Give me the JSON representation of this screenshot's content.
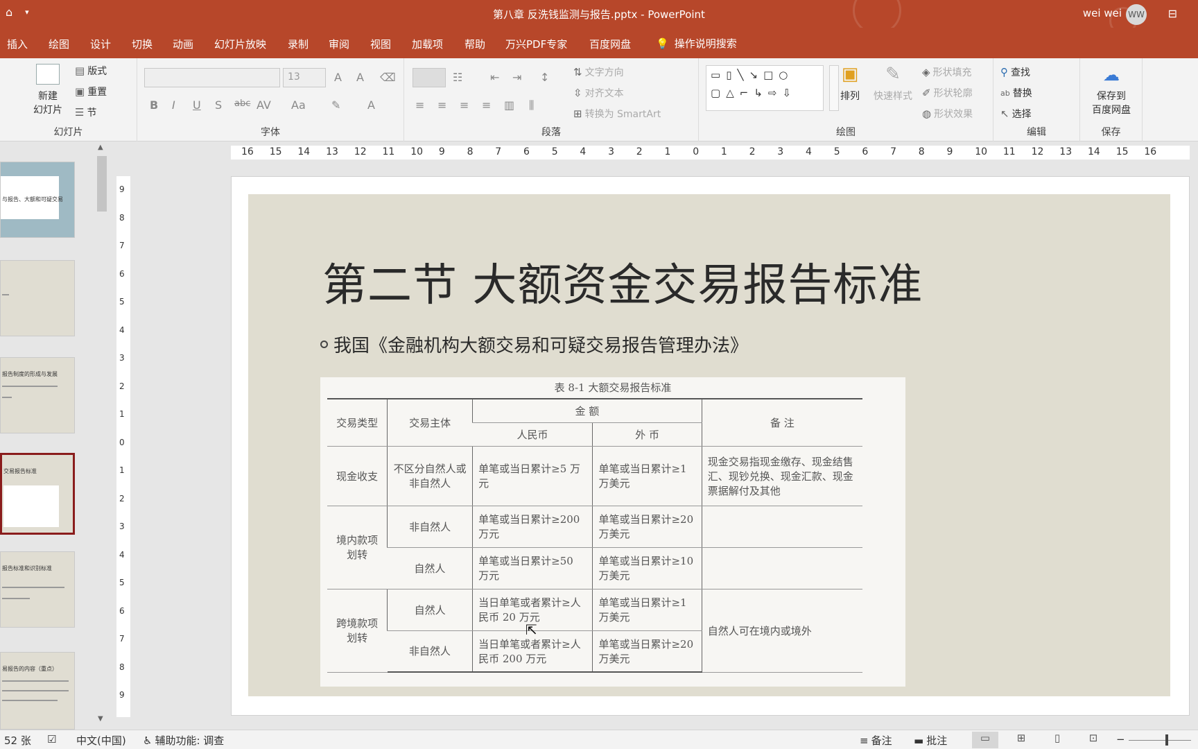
{
  "window": {
    "title": "第八章 反洗钱监测与报告.pptx  -  PowerPoint",
    "user_name": "wei wei",
    "avatar_initials": "WW"
  },
  "menu": {
    "tabs": [
      "插入",
      "绘图",
      "设计",
      "切换",
      "动画",
      "幻灯片放映",
      "录制",
      "审阅",
      "视图",
      "加载项",
      "帮助",
      "万兴PDF专家",
      "百度网盘"
    ],
    "tell_me": "操作说明搜索"
  },
  "ribbon": {
    "slides_group": {
      "label": "幻灯片",
      "new_slide": "新建",
      "new_slide_sub": "幻灯片",
      "layout": "版式",
      "reset": "重置",
      "section": "节"
    },
    "font_group": {
      "label": "字体",
      "font_size": "13",
      "bold": "B",
      "italic": "I",
      "underline": "U",
      "shadow": "S",
      "strike": "abc",
      "spacing": "AV",
      "case": "Aa"
    },
    "paragraph_group": {
      "label": "段落",
      "text_direction": "文字方向",
      "align_text": "对齐文本",
      "convert_smartart": "转换为 SmartArt"
    },
    "drawing_group": {
      "label": "绘图",
      "arrange": "排列",
      "quick_styles": "快速样式",
      "shape_fill": "形状填充",
      "shape_outline": "形状轮廓",
      "shape_effects": "形状效果"
    },
    "editing_group": {
      "label": "编辑",
      "find": "查找",
      "replace": "替换",
      "select": "选择"
    },
    "save_group": {
      "label": "保存",
      "save_to": "保存到",
      "save_to_sub": "百度网盘"
    }
  },
  "thumbnails": [
    {
      "title": "与报告、大额和可疑交易",
      "selected": false
    },
    {
      "title": "",
      "selected": false
    },
    {
      "title": "报告制度的形成与发展",
      "selected": false
    },
    {
      "title": "交易报告标准",
      "selected": true
    },
    {
      "title": "报告标准和识别标准",
      "selected": false
    },
    {
      "title": "易报告的内容（重点）",
      "selected": false
    }
  ],
  "ruler": {
    "h_labels": [
      "16",
      "15",
      "14",
      "13",
      "12",
      "11",
      "10",
      "9",
      "8",
      "7",
      "6",
      "5",
      "4",
      "3",
      "2",
      "1",
      "0",
      "1",
      "2",
      "3",
      "4",
      "5",
      "6",
      "7",
      "8",
      "9",
      "10",
      "11",
      "12",
      "13",
      "14",
      "15",
      "16"
    ],
    "v_labels": [
      "9",
      "8",
      "7",
      "6",
      "5",
      "4",
      "3",
      "2",
      "1",
      "0",
      "1",
      "2",
      "3",
      "4",
      "5",
      "6",
      "7",
      "8",
      "9"
    ]
  },
  "slide": {
    "title": "第二节 大额资金交易报告标准",
    "bullet": "我国《金融机构大额交易和可疑交易报告管理办法》",
    "table": {
      "caption": "表 8-1   大额交易报告标准",
      "headers": {
        "type": "交易类型",
        "subject": "交易主体",
        "amount": "金    额",
        "rmb": "人民币",
        "fx": "外   币",
        "note": "备     注"
      },
      "rows": [
        {
          "type": "现金收支",
          "subject": "不区分自然人或非自然人",
          "rmb": "单笔或当日累计≥5 万元",
          "fx": "单笔或当日累计≥1 万美元",
          "note": "现金交易指现金缴存、现金结售汇、现钞兑换、现金汇款、现金票据解付及其他"
        },
        {
          "type": "境内款项划转",
          "subject": "非自然人",
          "rmb": "单笔或当日累计≥200 万元",
          "fx": "单笔或当日累计≥20 万美元",
          "note": ""
        },
        {
          "type": "",
          "subject": "自然人",
          "rmb": "单笔或当日累计≥50 万元",
          "fx": "单笔或当日累计≥10 万美元",
          "note": ""
        },
        {
          "type": "跨境款项划转",
          "subject": "自然人",
          "rmb": "当日单笔或者累计≥人民币 20 万元",
          "fx": "单笔或当日累计≥1 万美元",
          "note": "自然人可在境内或境外"
        },
        {
          "type": "",
          "subject": "非自然人",
          "rmb": "当日单笔或者累计≥人民币 200 万元",
          "fx": "单笔或当日累计≥20 万美元",
          "note": ""
        }
      ]
    }
  },
  "status": {
    "slide_count": "52 张",
    "language": "中文(中国)",
    "accessibility": "辅助功能: 调查",
    "notes": "备注",
    "comments": "批注"
  }
}
